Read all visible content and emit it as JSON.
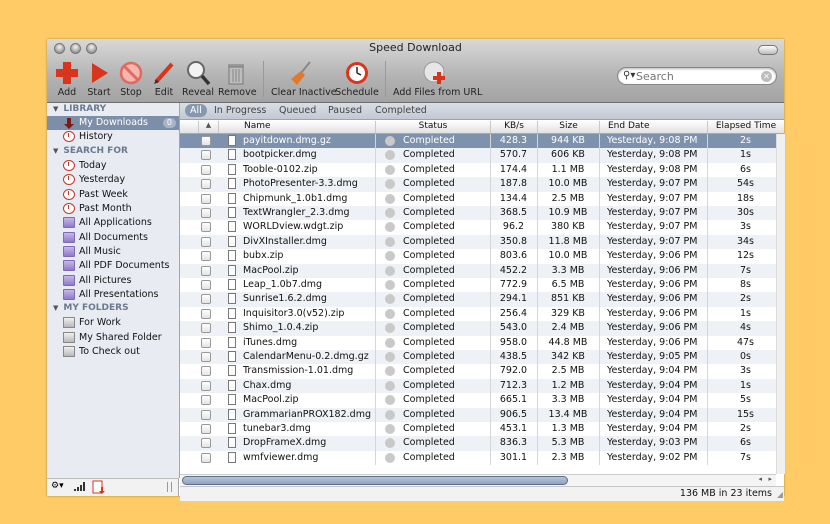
{
  "window": {
    "title": "Speed Download"
  },
  "toolbar": {
    "buttons": [
      {
        "label": "Add",
        "icon": "plus-icon"
      },
      {
        "label": "Start",
        "icon": "play-icon"
      },
      {
        "label": "Stop",
        "icon": "stop-icon"
      },
      {
        "label": "Edit",
        "icon": "pencil-icon"
      },
      {
        "label": "Reveal",
        "icon": "magnifier-icon"
      },
      {
        "label": "Remove",
        "icon": "trash-icon"
      },
      {
        "label": "Clear Inactive",
        "icon": "broom-icon"
      },
      {
        "label": "Schedule",
        "icon": "clock-icon"
      },
      {
        "label": "Add Files from URL",
        "icon": "globe-add-icon"
      }
    ],
    "search": {
      "placeholder": "Search",
      "value": ""
    }
  },
  "sidebar": {
    "sections": [
      {
        "title": "LIBRARY",
        "items": [
          {
            "label": "My Downloads",
            "badge": "0",
            "selected": true,
            "icon": "download-icon"
          },
          {
            "label": "History",
            "icon": "clock-icon"
          }
        ]
      },
      {
        "title": "SEARCH FOR",
        "items": [
          {
            "label": "Today",
            "icon": "clock-icon"
          },
          {
            "label": "Yesterday",
            "icon": "clock-icon"
          },
          {
            "label": "Past Week",
            "icon": "clock-icon"
          },
          {
            "label": "Past Month",
            "icon": "clock-icon"
          },
          {
            "label": "All Applications",
            "icon": "smart-folder-icon"
          },
          {
            "label": "All Documents",
            "icon": "smart-folder-icon"
          },
          {
            "label": "All Music",
            "icon": "smart-folder-icon"
          },
          {
            "label": "All PDF Documents",
            "icon": "smart-folder-icon"
          },
          {
            "label": "All Pictures",
            "icon": "smart-folder-icon"
          },
          {
            "label": "All Presentations",
            "icon": "smart-folder-icon"
          }
        ]
      },
      {
        "title": "MY FOLDERS",
        "items": [
          {
            "label": "For Work",
            "icon": "folder-icon"
          },
          {
            "label": "My Shared Folder",
            "icon": "folder-icon"
          },
          {
            "label": "To Check out",
            "icon": "folder-icon"
          }
        ]
      }
    ]
  },
  "filters": [
    {
      "label": "All",
      "active": true
    },
    {
      "label": "In Progress"
    },
    {
      "label": "Queued"
    },
    {
      "label": "Paused"
    },
    {
      "label": "Completed"
    }
  ],
  "table": {
    "columns": [
      "",
      "Name",
      "Status",
      "KB/s",
      "Size",
      "End Date",
      "Elapsed Time"
    ],
    "sort_indicator": "▲",
    "rows": [
      {
        "name": "payitdown.dmg.gz",
        "type": "zip",
        "status": "Completed",
        "kbs": "428.3",
        "size": "944 KB",
        "end": "Yesterday, 9:08 PM",
        "elapsed": "2s",
        "selected": true
      },
      {
        "name": "bootpicker.dmg",
        "type": "dmg",
        "status": "Completed",
        "kbs": "570.7",
        "size": "606 KB",
        "end": "Yesterday, 9:08 PM",
        "elapsed": "1s"
      },
      {
        "name": "Tooble-0102.zip",
        "type": "zip",
        "status": "Completed",
        "kbs": "174.4",
        "size": "1.1 MB",
        "end": "Yesterday, 9:08 PM",
        "elapsed": "6s"
      },
      {
        "name": "PhotoPresenter-3.3.dmg",
        "type": "dmg",
        "status": "Completed",
        "kbs": "187.8",
        "size": "10.0 MB",
        "end": "Yesterday, 9:07 PM",
        "elapsed": "54s"
      },
      {
        "name": "Chipmunk_1.0b1.dmg",
        "type": "dmg",
        "status": "Completed",
        "kbs": "134.4",
        "size": "2.5 MB",
        "end": "Yesterday, 9:07 PM",
        "elapsed": "18s"
      },
      {
        "name": "TextWrangler_2.3.dmg",
        "type": "dmg",
        "status": "Completed",
        "kbs": "368.5",
        "size": "10.9 MB",
        "end": "Yesterday, 9:07 PM",
        "elapsed": "30s"
      },
      {
        "name": "WORLDview.wdgt.zip",
        "type": "zip",
        "status": "Completed",
        "kbs": "96.2",
        "size": "380 KB",
        "end": "Yesterday, 9:07 PM",
        "elapsed": "3s"
      },
      {
        "name": "DivXInstaller.dmg",
        "type": "dmg",
        "status": "Completed",
        "kbs": "350.8",
        "size": "11.8 MB",
        "end": "Yesterday, 9:07 PM",
        "elapsed": "34s"
      },
      {
        "name": "bubx.zip",
        "type": "zip",
        "status": "Completed",
        "kbs": "803.6",
        "size": "10.0 MB",
        "end": "Yesterday, 9:06 PM",
        "elapsed": "12s"
      },
      {
        "name": "MacPool.zip",
        "type": "zip",
        "status": "Completed",
        "kbs": "452.2",
        "size": "3.3 MB",
        "end": "Yesterday, 9:06 PM",
        "elapsed": "7s"
      },
      {
        "name": "Leap_1.0b7.dmg",
        "type": "dmg",
        "status": "Completed",
        "kbs": "772.9",
        "size": "6.5 MB",
        "end": "Yesterday, 9:06 PM",
        "elapsed": "8s"
      },
      {
        "name": "Sunrise1.6.2.dmg",
        "type": "dmg",
        "status": "Completed",
        "kbs": "294.1",
        "size": "851 KB",
        "end": "Yesterday, 9:06 PM",
        "elapsed": "2s"
      },
      {
        "name": "Inquisitor3.0(v52).zip",
        "type": "zip",
        "status": "Completed",
        "kbs": "256.4",
        "size": "329 KB",
        "end": "Yesterday, 9:06 PM",
        "elapsed": "1s"
      },
      {
        "name": "Shimo_1.0.4.zip",
        "type": "zip",
        "status": "Completed",
        "kbs": "543.0",
        "size": "2.4 MB",
        "end": "Yesterday, 9:06 PM",
        "elapsed": "4s"
      },
      {
        "name": "iTunes.dmg",
        "type": "dmg",
        "status": "Completed",
        "kbs": "958.0",
        "size": "44.8 MB",
        "end": "Yesterday, 9:06 PM",
        "elapsed": "47s"
      },
      {
        "name": "CalendarMenu-0.2.dmg.gz",
        "type": "zip",
        "status": "Completed",
        "kbs": "438.5",
        "size": "342 KB",
        "end": "Yesterday, 9:05 PM",
        "elapsed": "0s"
      },
      {
        "name": "Transmission-1.01.dmg",
        "type": "dmg",
        "status": "Completed",
        "kbs": "792.0",
        "size": "2.5 MB",
        "end": "Yesterday, 9:04 PM",
        "elapsed": "3s"
      },
      {
        "name": "Chax.dmg",
        "type": "dmg",
        "status": "Completed",
        "kbs": "712.3",
        "size": "1.2 MB",
        "end": "Yesterday, 9:04 PM",
        "elapsed": "1s"
      },
      {
        "name": "MacPool.zip",
        "type": "zip",
        "status": "Completed",
        "kbs": "665.1",
        "size": "3.3 MB",
        "end": "Yesterday, 9:04 PM",
        "elapsed": "5s"
      },
      {
        "name": "GrammarianPROX182.dmg",
        "type": "dmg",
        "status": "Completed",
        "kbs": "906.5",
        "size": "13.4 MB",
        "end": "Yesterday, 9:04 PM",
        "elapsed": "15s"
      },
      {
        "name": "tunebar3.dmg",
        "type": "dmg",
        "status": "Completed",
        "kbs": "453.1",
        "size": "1.3 MB",
        "end": "Yesterday, 9:04 PM",
        "elapsed": "2s"
      },
      {
        "name": "DropFrameX.dmg",
        "type": "dmg",
        "status": "Completed",
        "kbs": "836.3",
        "size": "5.3 MB",
        "end": "Yesterday, 9:03 PM",
        "elapsed": "6s"
      },
      {
        "name": "wmfviewer.dmg",
        "type": "dmg",
        "status": "Completed",
        "kbs": "301.1",
        "size": "2.3 MB",
        "end": "Yesterday, 9:02 PM",
        "elapsed": "7s"
      }
    ]
  },
  "statusbar": {
    "summary": "136 MB in 23 items"
  },
  "colors": {
    "background": "#ffcb66",
    "selection": "#7e92ad",
    "accent_red": "#d9341c"
  }
}
